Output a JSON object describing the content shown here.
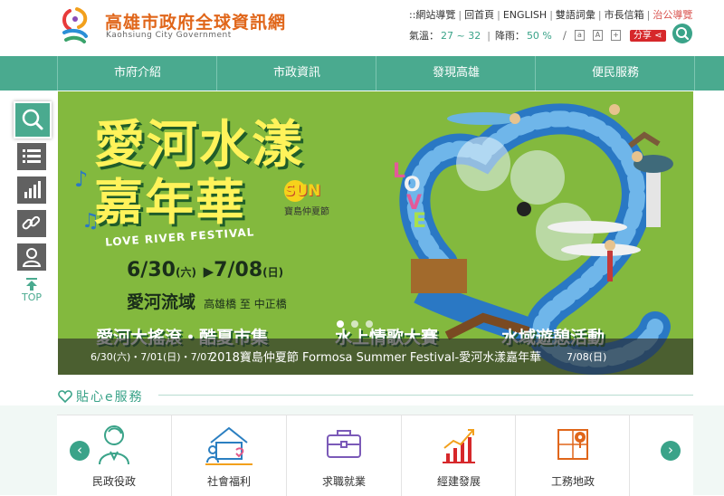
{
  "header": {
    "title": "高雄市政府全球資訊網",
    "subtitle": "Kaohsiung City Government",
    "top_links": [
      "::網站導覽",
      "回首頁",
      "ENGLISH",
      "雙語詞彙",
      "市長信箱",
      "治公導覽"
    ],
    "weather": {
      "temp_label": "氣溫：",
      "temp_value": "27 ~ 32",
      "rain_label": "降雨：",
      "rain_value": "50 %"
    },
    "share_label": "分享"
  },
  "nav": {
    "items": [
      "市府介紹",
      "市政資訊",
      "發現高雄",
      "便民服務"
    ]
  },
  "banner": {
    "title_line1": "愛河水漾",
    "title_line2": "嘉年華",
    "sun_text": "SUN",
    "festival_text": "寶島仲夏節",
    "english": "LOVE RIVER FESTIVAL",
    "date_start": "6/30",
    "day_start": "(六)",
    "date_arrow": "▶",
    "date_end": "7/08",
    "day_end": "(日)",
    "venue": "愛河流域",
    "bridges": "高雄橋 至 中正橋",
    "events": [
      "愛河大搖滾・酷夏市集",
      "水上情歌大賽",
      "水域遊憩活動"
    ],
    "event_dates": [
      "6/30(六)・7/01(日)・7/07",
      "7/08(日)"
    ],
    "caption": "2018寶島仲夏節 Formosa Summer Festival-愛河水漾嘉年華",
    "slide_count": 3,
    "active_slide": 0
  },
  "sidebar": {
    "top_label": "TOP"
  },
  "services": {
    "title": "貼心e服務",
    "items": [
      {
        "label": "民政役政",
        "icon": "civil-affairs-icon"
      },
      {
        "label": "社會福利",
        "icon": "social-welfare-icon"
      },
      {
        "label": "求職就業",
        "icon": "employment-icon"
      },
      {
        "label": "經建發展",
        "icon": "economic-development-icon"
      },
      {
        "label": "工務地政",
        "icon": "public-works-icon"
      }
    ],
    "prev_label": "‹",
    "next_label": "›"
  },
  "colors": {
    "brand_green": "#4aaa8f",
    "title_orange": "#e0661a",
    "banner_green": "#7fb53b",
    "share_red": "#d6282b"
  }
}
